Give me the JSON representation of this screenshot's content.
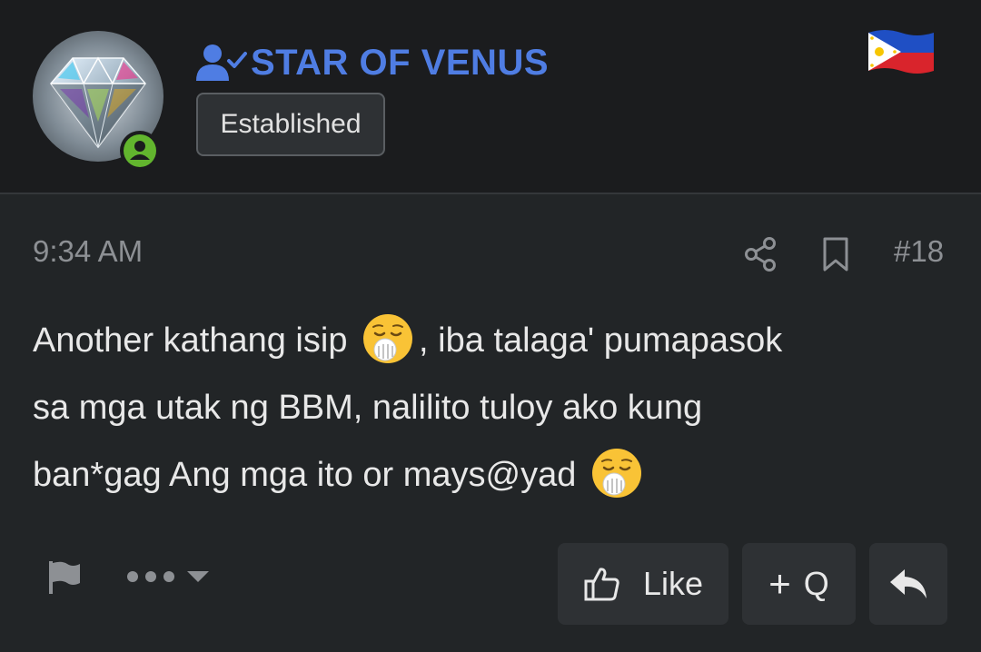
{
  "author": {
    "username": "STAR OF VENUS",
    "role": "Established",
    "online": true,
    "avatar_icon": "diamond-avatar",
    "country_flag": "philippines-flag"
  },
  "post": {
    "time": "9:34 AM",
    "number": "#18",
    "body_lines": [
      "Another kathang isip",
      ", iba talaga' pumapasok",
      "sa mga utak ng BBM, nalilito tuloy ako kung",
      "ban*gag Ang mga ito or mays@yad"
    ],
    "emoji": "yawning-face"
  },
  "actions": {
    "like_label": "Like",
    "quote_label": "Q",
    "quote_prefix": "+",
    "icons": [
      "share-icon",
      "bookmark-icon",
      "report-flag-icon",
      "more-icon",
      "thumbs-up-icon",
      "reply-icon"
    ]
  },
  "colors": {
    "username": "#4f7de3",
    "online": "#62b52e",
    "background": "#222527",
    "header_bg": "#1b1c1e",
    "muted": "#8d9094"
  }
}
